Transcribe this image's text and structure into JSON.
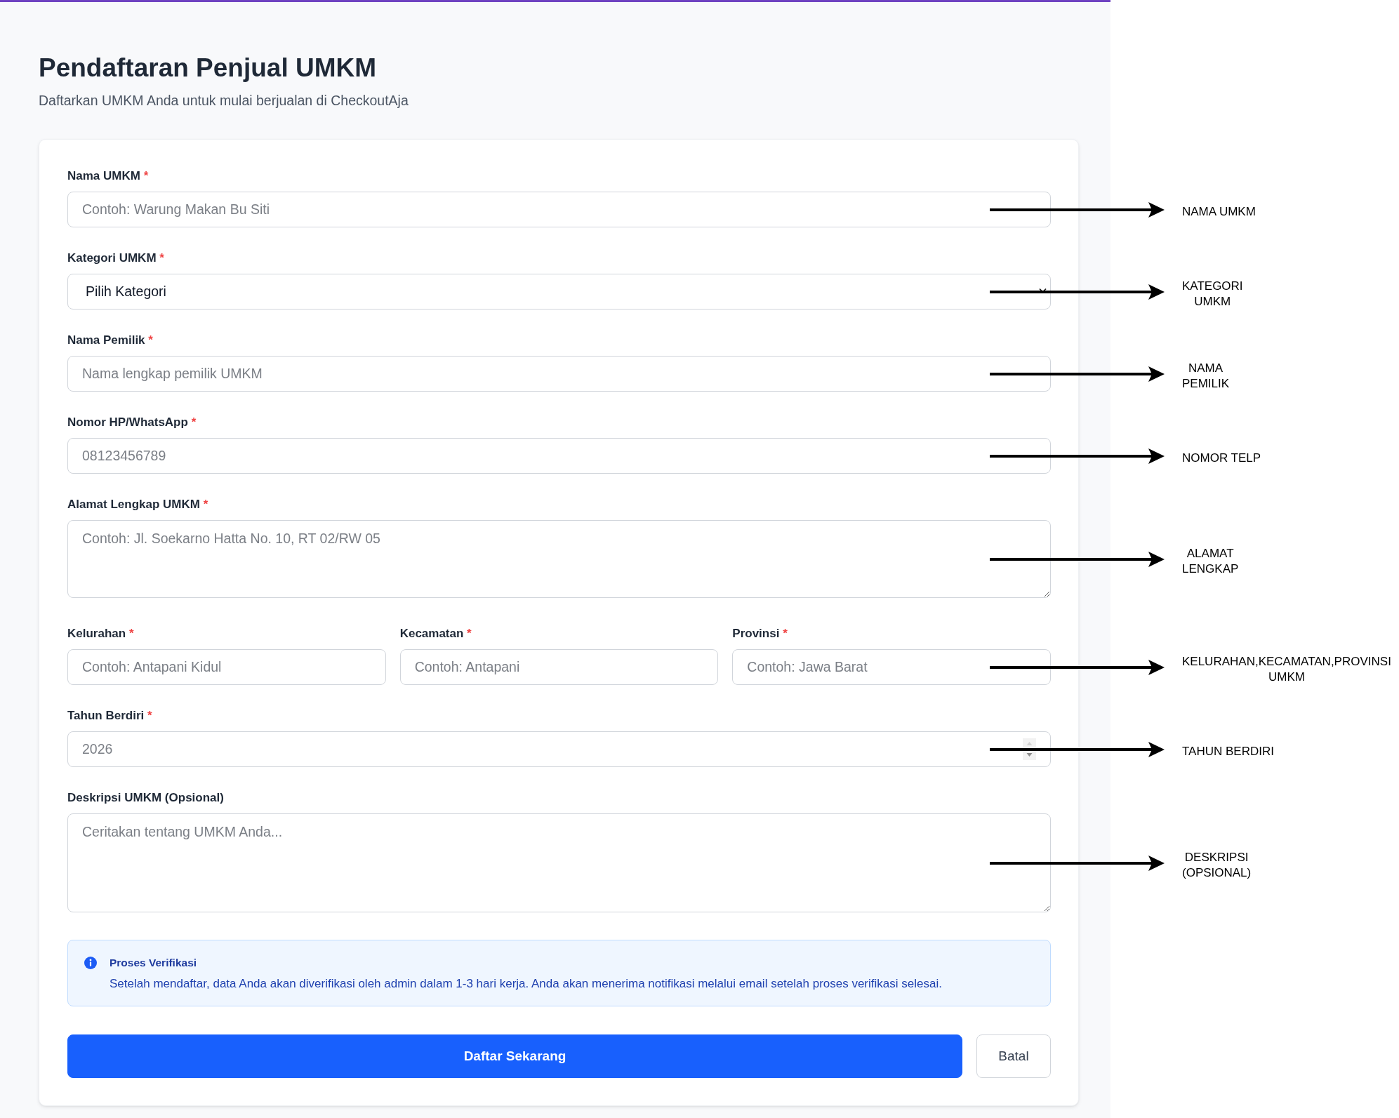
{
  "page": {
    "title": "Pendaftaran Penjual UMKM",
    "subtitle": "Daftarkan UMKM Anda untuk mulai berjualan di CheckoutAja"
  },
  "form": {
    "fields": [
      {
        "kind": "text",
        "label": "Nama UMKM",
        "required_mark": "*",
        "placeholder": "Contoh: Warung Makan Bu Siti",
        "annotation": [
          "NAMA UMKM"
        ]
      },
      {
        "kind": "select",
        "label": "Kategori UMKM",
        "required_mark": "*",
        "value": "Pilih Kategori",
        "annotation": [
          "KATEGORI",
          "UMKM"
        ]
      },
      {
        "kind": "text",
        "label": "Nama Pemilik",
        "required_mark": "*",
        "placeholder": "Nama lengkap pemilik UMKM",
        "annotation": [
          "NAMA",
          "PEMILIK"
        ]
      },
      {
        "kind": "text",
        "label": "Nomor HP/WhatsApp",
        "required_mark": "*",
        "placeholder": "08123456789",
        "annotation": [
          "NOMOR TELP"
        ]
      },
      {
        "kind": "textarea",
        "label": "Alamat Lengkap UMKM",
        "required_mark": "*",
        "placeholder": "Contoh: Jl. Soekarno Hatta No. 10, RT 02/RW 05",
        "annotation": [
          "ALAMAT",
          "LENGKAP"
        ]
      },
      {
        "kind": "row",
        "fields": [
          {
            "kind": "text",
            "label": "Kelurahan",
            "required_mark": "*",
            "placeholder": "Contoh: Antapani Kidul"
          },
          {
            "kind": "text",
            "label": "Kecamatan",
            "required_mark": "*",
            "placeholder": "Contoh: Antapani"
          },
          {
            "kind": "text",
            "label": "Provinsi",
            "required_mark": "*",
            "placeholder": "Contoh: Jawa Barat"
          }
        ],
        "annotation": [
          "KELURAHAN,KECAMATAN,PROVINSI",
          "UMKM"
        ]
      },
      {
        "kind": "number",
        "label": "Tahun Berdiri",
        "required_mark": "*",
        "placeholder": "2026",
        "annotation": [
          "TAHUN BERDIRI"
        ]
      },
      {
        "kind": "textarea",
        "label": "Deskripsi UMKM (Opsional)",
        "placeholder": "Ceritakan tentang UMKM Anda...",
        "annotation": [
          "DESKRIPSI",
          "(OPSIONAL)"
        ]
      }
    ]
  },
  "notice": {
    "title": "Proses Verifikasi",
    "message": "Setelah mendaftar, data Anda akan diverifikasi oleh admin dalam 1-3 hari kerja. Anda akan menerima notifikasi melalui email setelah proses verifikasi selesai."
  },
  "buttons": [
    {
      "kind": "primary",
      "label": "Daftar Sekarang"
    },
    {
      "kind": "secondary",
      "label": "Batal"
    }
  ]
}
